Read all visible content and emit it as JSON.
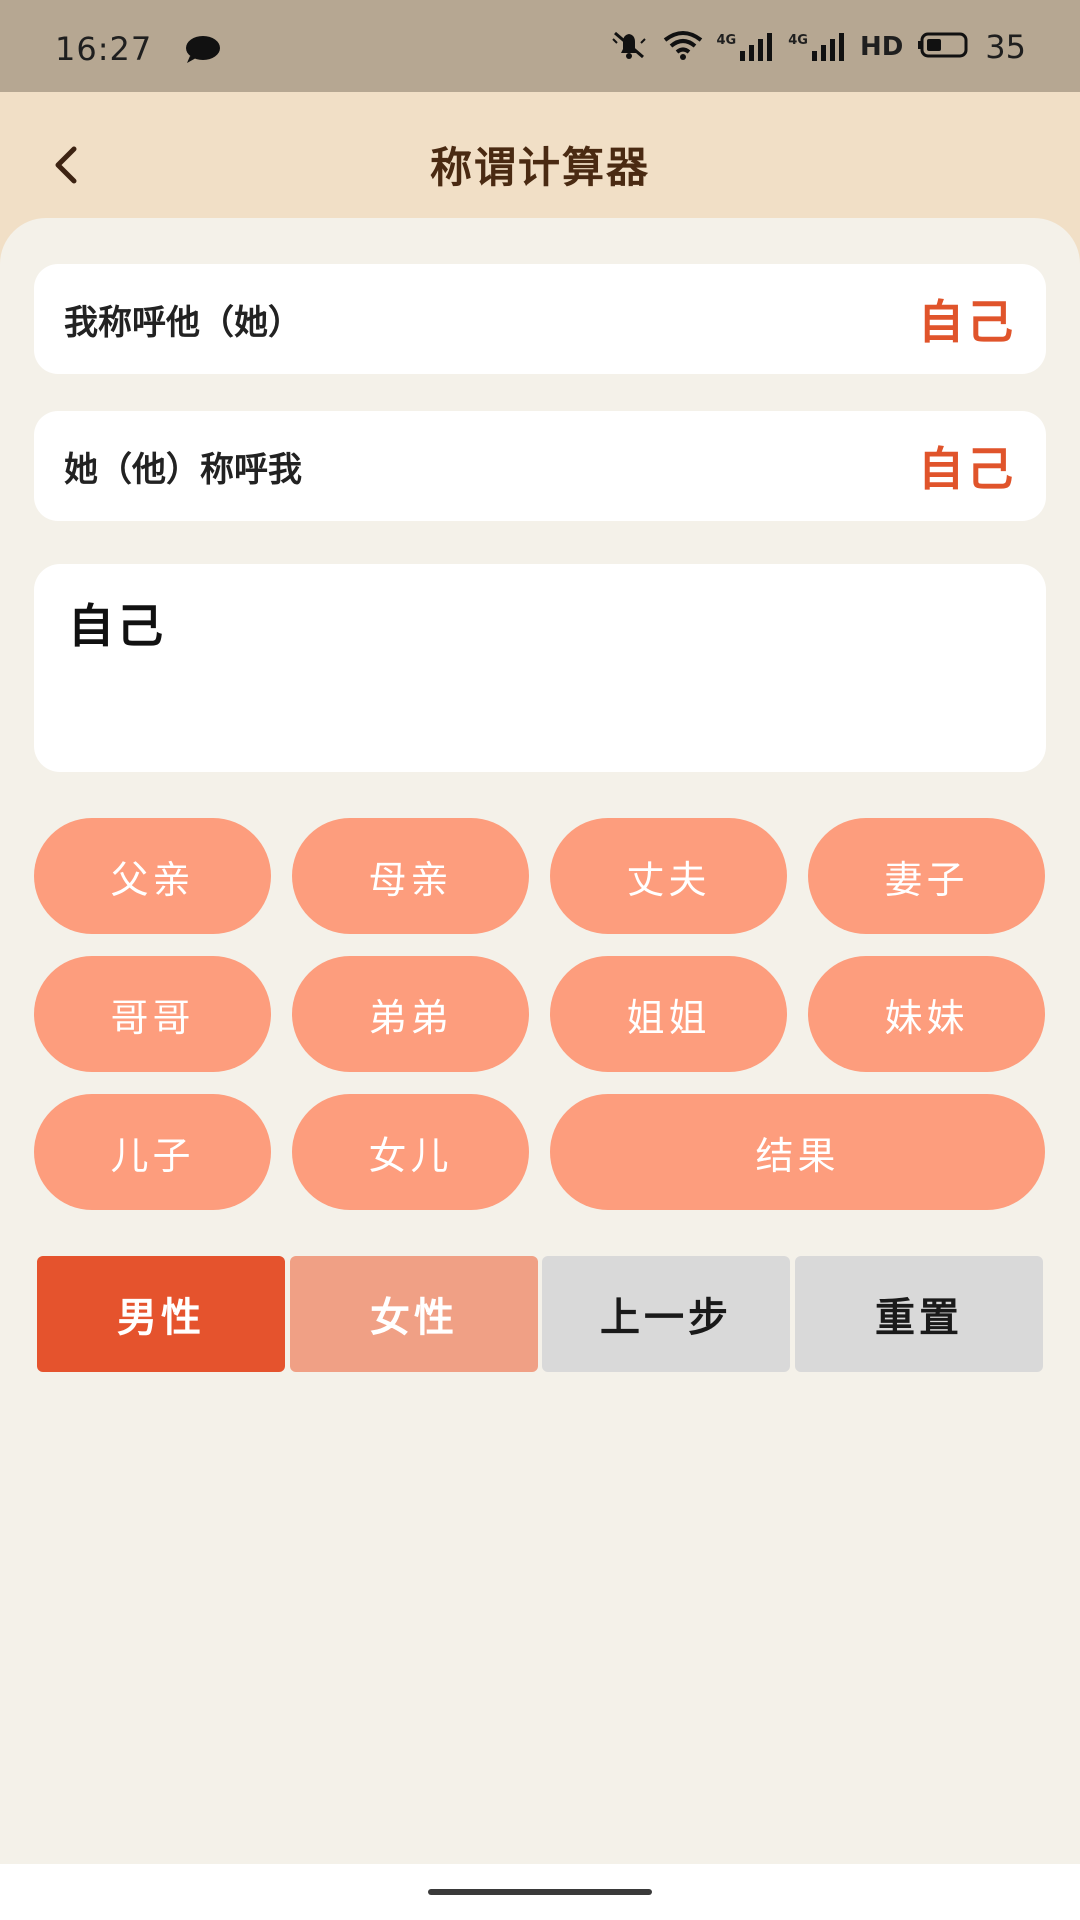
{
  "status_bar": {
    "time": "16:27",
    "network_1": "4G",
    "network_2": "4G",
    "hd": "HD",
    "battery": "35",
    "icons": [
      "chat-bubble-icon",
      "mute-icon",
      "wifi-icon",
      "signal-icon",
      "signal-icon",
      "battery-icon"
    ]
  },
  "header": {
    "title": "称谓计算器",
    "back_icon": "chevron-left-icon"
  },
  "rows": {
    "i_call": {
      "label": "我称呼他（她）",
      "value": "自己"
    },
    "they_call": {
      "label": "她（他）称呼我",
      "value": "自己"
    }
  },
  "result": {
    "text": "自己"
  },
  "relations": {
    "father": "父亲",
    "mother": "母亲",
    "husband": "丈夫",
    "wife": "妻子",
    "elder_brother": "哥哥",
    "younger_brother": "弟弟",
    "elder_sister": "姐姐",
    "younger_sister": "妹妹",
    "son": "儿子",
    "daughter": "女儿",
    "result_button": "结果"
  },
  "actions": {
    "male": "男性",
    "female": "女性",
    "previous": "上一步",
    "reset": "重置"
  },
  "colors": {
    "accent": "#e0542b",
    "pill": "#fd9d7d",
    "male_active": "#e5532d",
    "female": "#f0a085",
    "neutral": "#d9d9d9",
    "header_bg": "#f1dfc6",
    "status_bg": "#b6a792"
  }
}
